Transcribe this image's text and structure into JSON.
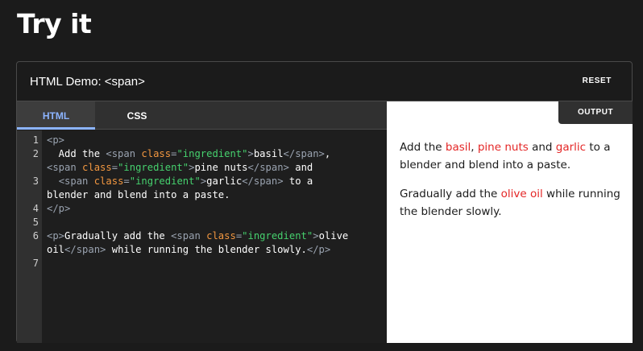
{
  "page": {
    "title": "Try it"
  },
  "demo": {
    "title": "HTML Demo: <span>",
    "reset_label": "RESET",
    "tabs": [
      {
        "label": "HTML",
        "active": true
      },
      {
        "label": "CSS",
        "active": false
      }
    ],
    "output_label": "OUTPUT"
  },
  "editor": {
    "line_numbers": [
      "1",
      "2",
      "3",
      "4",
      "5",
      "6",
      "7"
    ],
    "lines": [
      {
        "number": "1",
        "tokens": [
          {
            "t": "tag",
            "v": "<p>"
          }
        ]
      },
      {
        "number": "2",
        "tokens": [
          {
            "t": "txt",
            "v": "  Add the "
          },
          {
            "t": "tag",
            "v": "<span "
          },
          {
            "t": "attr",
            "v": "class"
          },
          {
            "t": "tag",
            "v": "="
          },
          {
            "t": "str",
            "v": "\"ingredient\""
          },
          {
            "t": "tag",
            "v": ">"
          },
          {
            "t": "txt",
            "v": "basil"
          },
          {
            "t": "tag",
            "v": "</span>"
          },
          {
            "t": "txt",
            "v": ","
          }
        ]
      },
      {
        "number": "",
        "tokens": [
          {
            "t": "tag",
            "v": "<span "
          },
          {
            "t": "attr",
            "v": "class"
          },
          {
            "t": "tag",
            "v": "="
          },
          {
            "t": "str",
            "v": "\"ingredient\""
          },
          {
            "t": "tag",
            "v": ">"
          },
          {
            "t": "txt",
            "v": "pine nuts"
          },
          {
            "t": "tag",
            "v": "</span>"
          },
          {
            "t": "txt",
            "v": " and"
          }
        ]
      },
      {
        "number": "3",
        "tokens": [
          {
            "t": "txt",
            "v": "  "
          },
          {
            "t": "tag",
            "v": "<span "
          },
          {
            "t": "attr",
            "v": "class"
          },
          {
            "t": "tag",
            "v": "="
          },
          {
            "t": "str",
            "v": "\"ingredient\""
          },
          {
            "t": "tag",
            "v": ">"
          },
          {
            "t": "txt",
            "v": "garlic"
          },
          {
            "t": "tag",
            "v": "</span>"
          },
          {
            "t": "txt",
            "v": " to a"
          }
        ]
      },
      {
        "number": "",
        "tokens": [
          {
            "t": "txt",
            "v": "blender and blend into a paste."
          }
        ]
      },
      {
        "number": "4",
        "tokens": [
          {
            "t": "tag",
            "v": "</p>"
          }
        ]
      },
      {
        "number": "5",
        "tokens": []
      },
      {
        "number": "6",
        "tokens": [
          {
            "t": "tag",
            "v": "<p>"
          },
          {
            "t": "txt",
            "v": "Gradually add the "
          },
          {
            "t": "tag",
            "v": "<span "
          },
          {
            "t": "attr",
            "v": "class"
          },
          {
            "t": "tag",
            "v": "="
          },
          {
            "t": "str",
            "v": "\"ingredient\""
          },
          {
            "t": "tag",
            "v": ">"
          },
          {
            "t": "txt",
            "v": "olive"
          }
        ]
      },
      {
        "number": "",
        "tokens": [
          {
            "t": "txt",
            "v": "oil"
          },
          {
            "t": "tag",
            "v": "</span>"
          },
          {
            "t": "txt",
            "v": " while running the blender slowly."
          },
          {
            "t": "tag",
            "v": "</p>"
          }
        ]
      },
      {
        "number": "7",
        "tokens": []
      }
    ]
  },
  "output": {
    "paragraphs": [
      [
        {
          "t": "txt",
          "v": "Add the "
        },
        {
          "t": "ing",
          "v": "basil"
        },
        {
          "t": "txt",
          "v": ", "
        },
        {
          "t": "ing",
          "v": "pine nuts"
        },
        {
          "t": "txt",
          "v": " and "
        },
        {
          "t": "ing",
          "v": "garlic"
        },
        {
          "t": "txt",
          "v": " to a blender and blend into a paste."
        }
      ],
      [
        {
          "t": "txt",
          "v": "Gradually add the "
        },
        {
          "t": "ing",
          "v": "olive oil"
        },
        {
          "t": "txt",
          "v": " while running the blender slowly."
        }
      ]
    ]
  },
  "colors": {
    "background": "#1b1b1b",
    "active_tab": "#8cb4ff",
    "code_tag": "#9aa3b0",
    "code_attr": "#f29740",
    "code_string": "#46d16e",
    "ingredient": "#e42626"
  }
}
